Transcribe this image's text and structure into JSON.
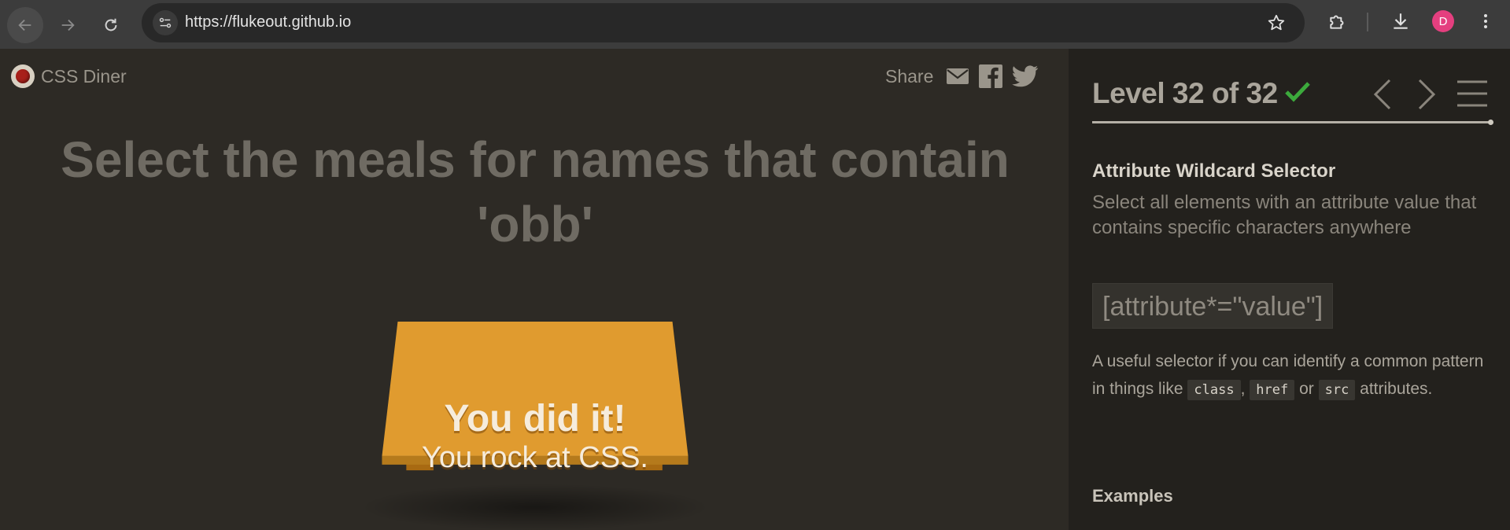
{
  "browser": {
    "url": "https://flukeout.github.io",
    "profile_initial": "D"
  },
  "header": {
    "logo_text": "CSS Diner",
    "share_label": "Share"
  },
  "game": {
    "instruction": "Select the meals for names that contain 'obb'",
    "win_line1": "You did it!",
    "win_line2": "You rock at CSS."
  },
  "sidebar": {
    "level_label": "Level 32 of 32",
    "level_progress": 1.0,
    "selector_name": "Attribute Wildcard Selector",
    "selector_description": "Select all elements with an attribute value that contains specific characters anywhere",
    "syntax": "[attribute*=\"value\"]",
    "help_text_1": "A useful selector if you can identify a common pattern in things like",
    "code_class": "class",
    "help_comma": ",",
    "code_href": "href",
    "help_or": "or",
    "code_src": "src",
    "help_text_2": "attributes.",
    "examples_heading": "Examples"
  },
  "colors": {
    "table": "#e09b2f",
    "check": "#3caa3c",
    "background": "#2d2a25",
    "sidebar": "#23211d"
  },
  "icons": [
    "back-icon",
    "forward-icon",
    "reload-icon",
    "site-info-icon",
    "bookmark-star-icon",
    "extensions-icon",
    "download-icon",
    "more-vert-icon",
    "email-icon",
    "facebook-icon",
    "twitter-icon",
    "checkmark-icon",
    "chevron-left-icon",
    "chevron-right-icon",
    "menu-icon"
  ]
}
